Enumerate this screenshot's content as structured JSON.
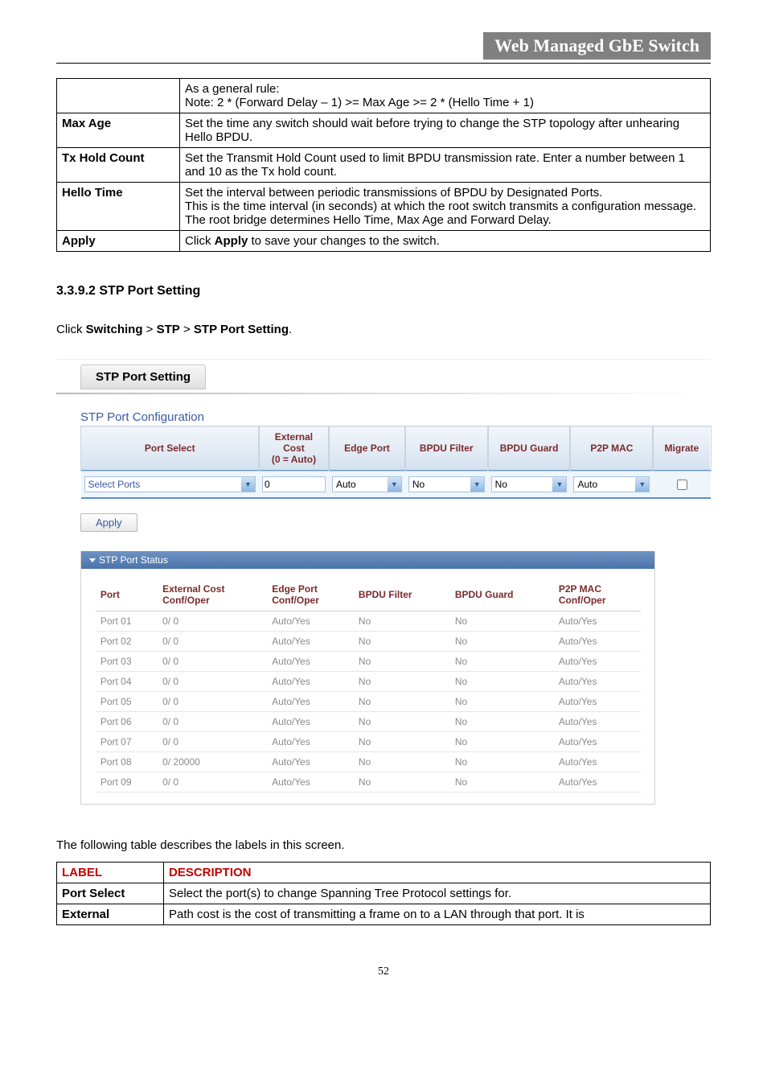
{
  "header": {
    "title": "Web Managed GbE Switch"
  },
  "param_table": {
    "rows": [
      {
        "label": "",
        "desc": "As a general rule:\nNote: 2 * (Forward Delay – 1) >= Max Age >= 2 * (Hello Time + 1)"
      },
      {
        "label": "Max Age",
        "desc": "Set the time any switch should wait before trying to change the STP topology after unhearing Hello BPDU."
      },
      {
        "label": "Tx Hold Count",
        "desc": "Set the Transmit Hold Count used to limit BPDU transmission rate. Enter a number between 1 and 10 as the Tx hold count."
      },
      {
        "label": "Hello Time",
        "desc": "Set the interval between periodic transmissions of BPDU by Designated Ports.\nThis is the time interval (in seconds) at which the root switch transmits a configuration message. The root bridge determines Hello Time, Max Age and Forward Delay."
      },
      {
        "label": "Apply",
        "desc_pre": "Click ",
        "desc_bold": "Apply",
        "desc_post": " to save your changes to the switch."
      }
    ]
  },
  "section_heading": "3.3.9.2 STP Port Setting",
  "breadcrumb": {
    "pre": "Click ",
    "p1": "Switching",
    "sep": " > ",
    "p2": "STP",
    "p3": "STP Port Setting",
    "post": "."
  },
  "shot": {
    "tab_label": "STP Port Setting",
    "subtitle": "STP Port Configuration",
    "cfg_headers": {
      "port_select": "Port Select",
      "ext_cost": "External\nCost\n(0 = Auto)",
      "edge_port": "Edge Port",
      "bpdu_filter": "BPDU Filter",
      "bpdu_guard": "BPDU Guard",
      "p2p_mac": "P2P MAC",
      "migrate": "Migrate"
    },
    "cfg_values": {
      "port_select": "Select Ports",
      "ext_cost": "0",
      "edge_port": "Auto",
      "bpdu_filter": "No",
      "bpdu_guard": "No",
      "p2p_mac": "Auto"
    },
    "apply_label": "Apply",
    "status_banner": "STP Port Status",
    "status_headers": {
      "port": "Port",
      "ext": "External Cost\nConf/Oper",
      "edge": "Edge Port\nConf/Oper",
      "filter": "BPDU Filter",
      "guard": "BPDU Guard",
      "p2p": "P2P MAC\nConf/Oper"
    },
    "status_rows": [
      {
        "port": "Port 01",
        "ext": "0/ 0",
        "edge": "Auto/Yes",
        "filter": "No",
        "guard": "No",
        "p2p": "Auto/Yes"
      },
      {
        "port": "Port 02",
        "ext": "0/ 0",
        "edge": "Auto/Yes",
        "filter": "No",
        "guard": "No",
        "p2p": "Auto/Yes"
      },
      {
        "port": "Port 03",
        "ext": "0/ 0",
        "edge": "Auto/Yes",
        "filter": "No",
        "guard": "No",
        "p2p": "Auto/Yes"
      },
      {
        "port": "Port 04",
        "ext": "0/ 0",
        "edge": "Auto/Yes",
        "filter": "No",
        "guard": "No",
        "p2p": "Auto/Yes"
      },
      {
        "port": "Port 05",
        "ext": "0/ 0",
        "edge": "Auto/Yes",
        "filter": "No",
        "guard": "No",
        "p2p": "Auto/Yes"
      },
      {
        "port": "Port 06",
        "ext": "0/ 0",
        "edge": "Auto/Yes",
        "filter": "No",
        "guard": "No",
        "p2p": "Auto/Yes"
      },
      {
        "port": "Port 07",
        "ext": "0/ 0",
        "edge": "Auto/Yes",
        "filter": "No",
        "guard": "No",
        "p2p": "Auto/Yes"
      },
      {
        "port": "Port 08",
        "ext": "0/ 20000",
        "edge": "Auto/Yes",
        "filter": "No",
        "guard": "No",
        "p2p": "Auto/Yes"
      },
      {
        "port": "Port 09",
        "ext": "0/ 0",
        "edge": "Auto/Yes",
        "filter": "No",
        "guard": "No",
        "p2p": "Auto/Yes"
      }
    ]
  },
  "after_text": "The following table describes the labels in this screen.",
  "desc_table": {
    "h_label": "LABEL",
    "h_desc": "DESCRIPTION",
    "rows": [
      {
        "label": "Port Select",
        "desc": "Select the port(s) to change Spanning Tree Protocol settings for."
      },
      {
        "label": "External",
        "desc": "Path cost is the cost of transmitting a frame on to a LAN through that port. It is"
      }
    ]
  },
  "page_number": "52"
}
